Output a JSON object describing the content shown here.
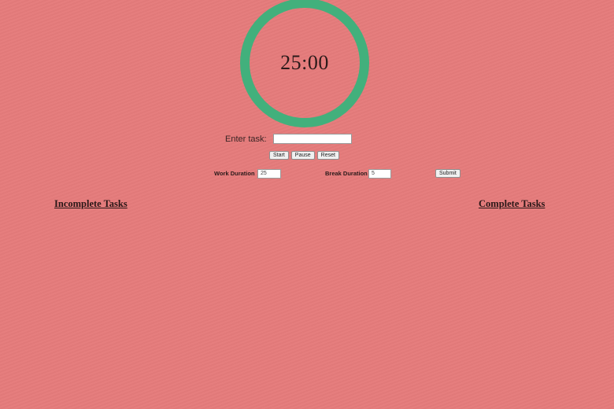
{
  "timer": {
    "display": "25:00",
    "ring_color": "#42b07c"
  },
  "task_entry": {
    "label": "Enter task:",
    "value": "",
    "placeholder": ""
  },
  "controls": {
    "start_label": "Start",
    "pause_label": "Pause",
    "reset_label": "Reset"
  },
  "durations": {
    "work_label": "Work Duration",
    "work_value": "25",
    "break_label": "Break Duration",
    "break_value": "5",
    "submit_label": "Submit"
  },
  "lists": {
    "incomplete_heading": "Incomplete Tasks",
    "complete_heading": "Complete Tasks"
  },
  "theme": {
    "background": "#e57b7b",
    "accent": "#42b07c"
  }
}
